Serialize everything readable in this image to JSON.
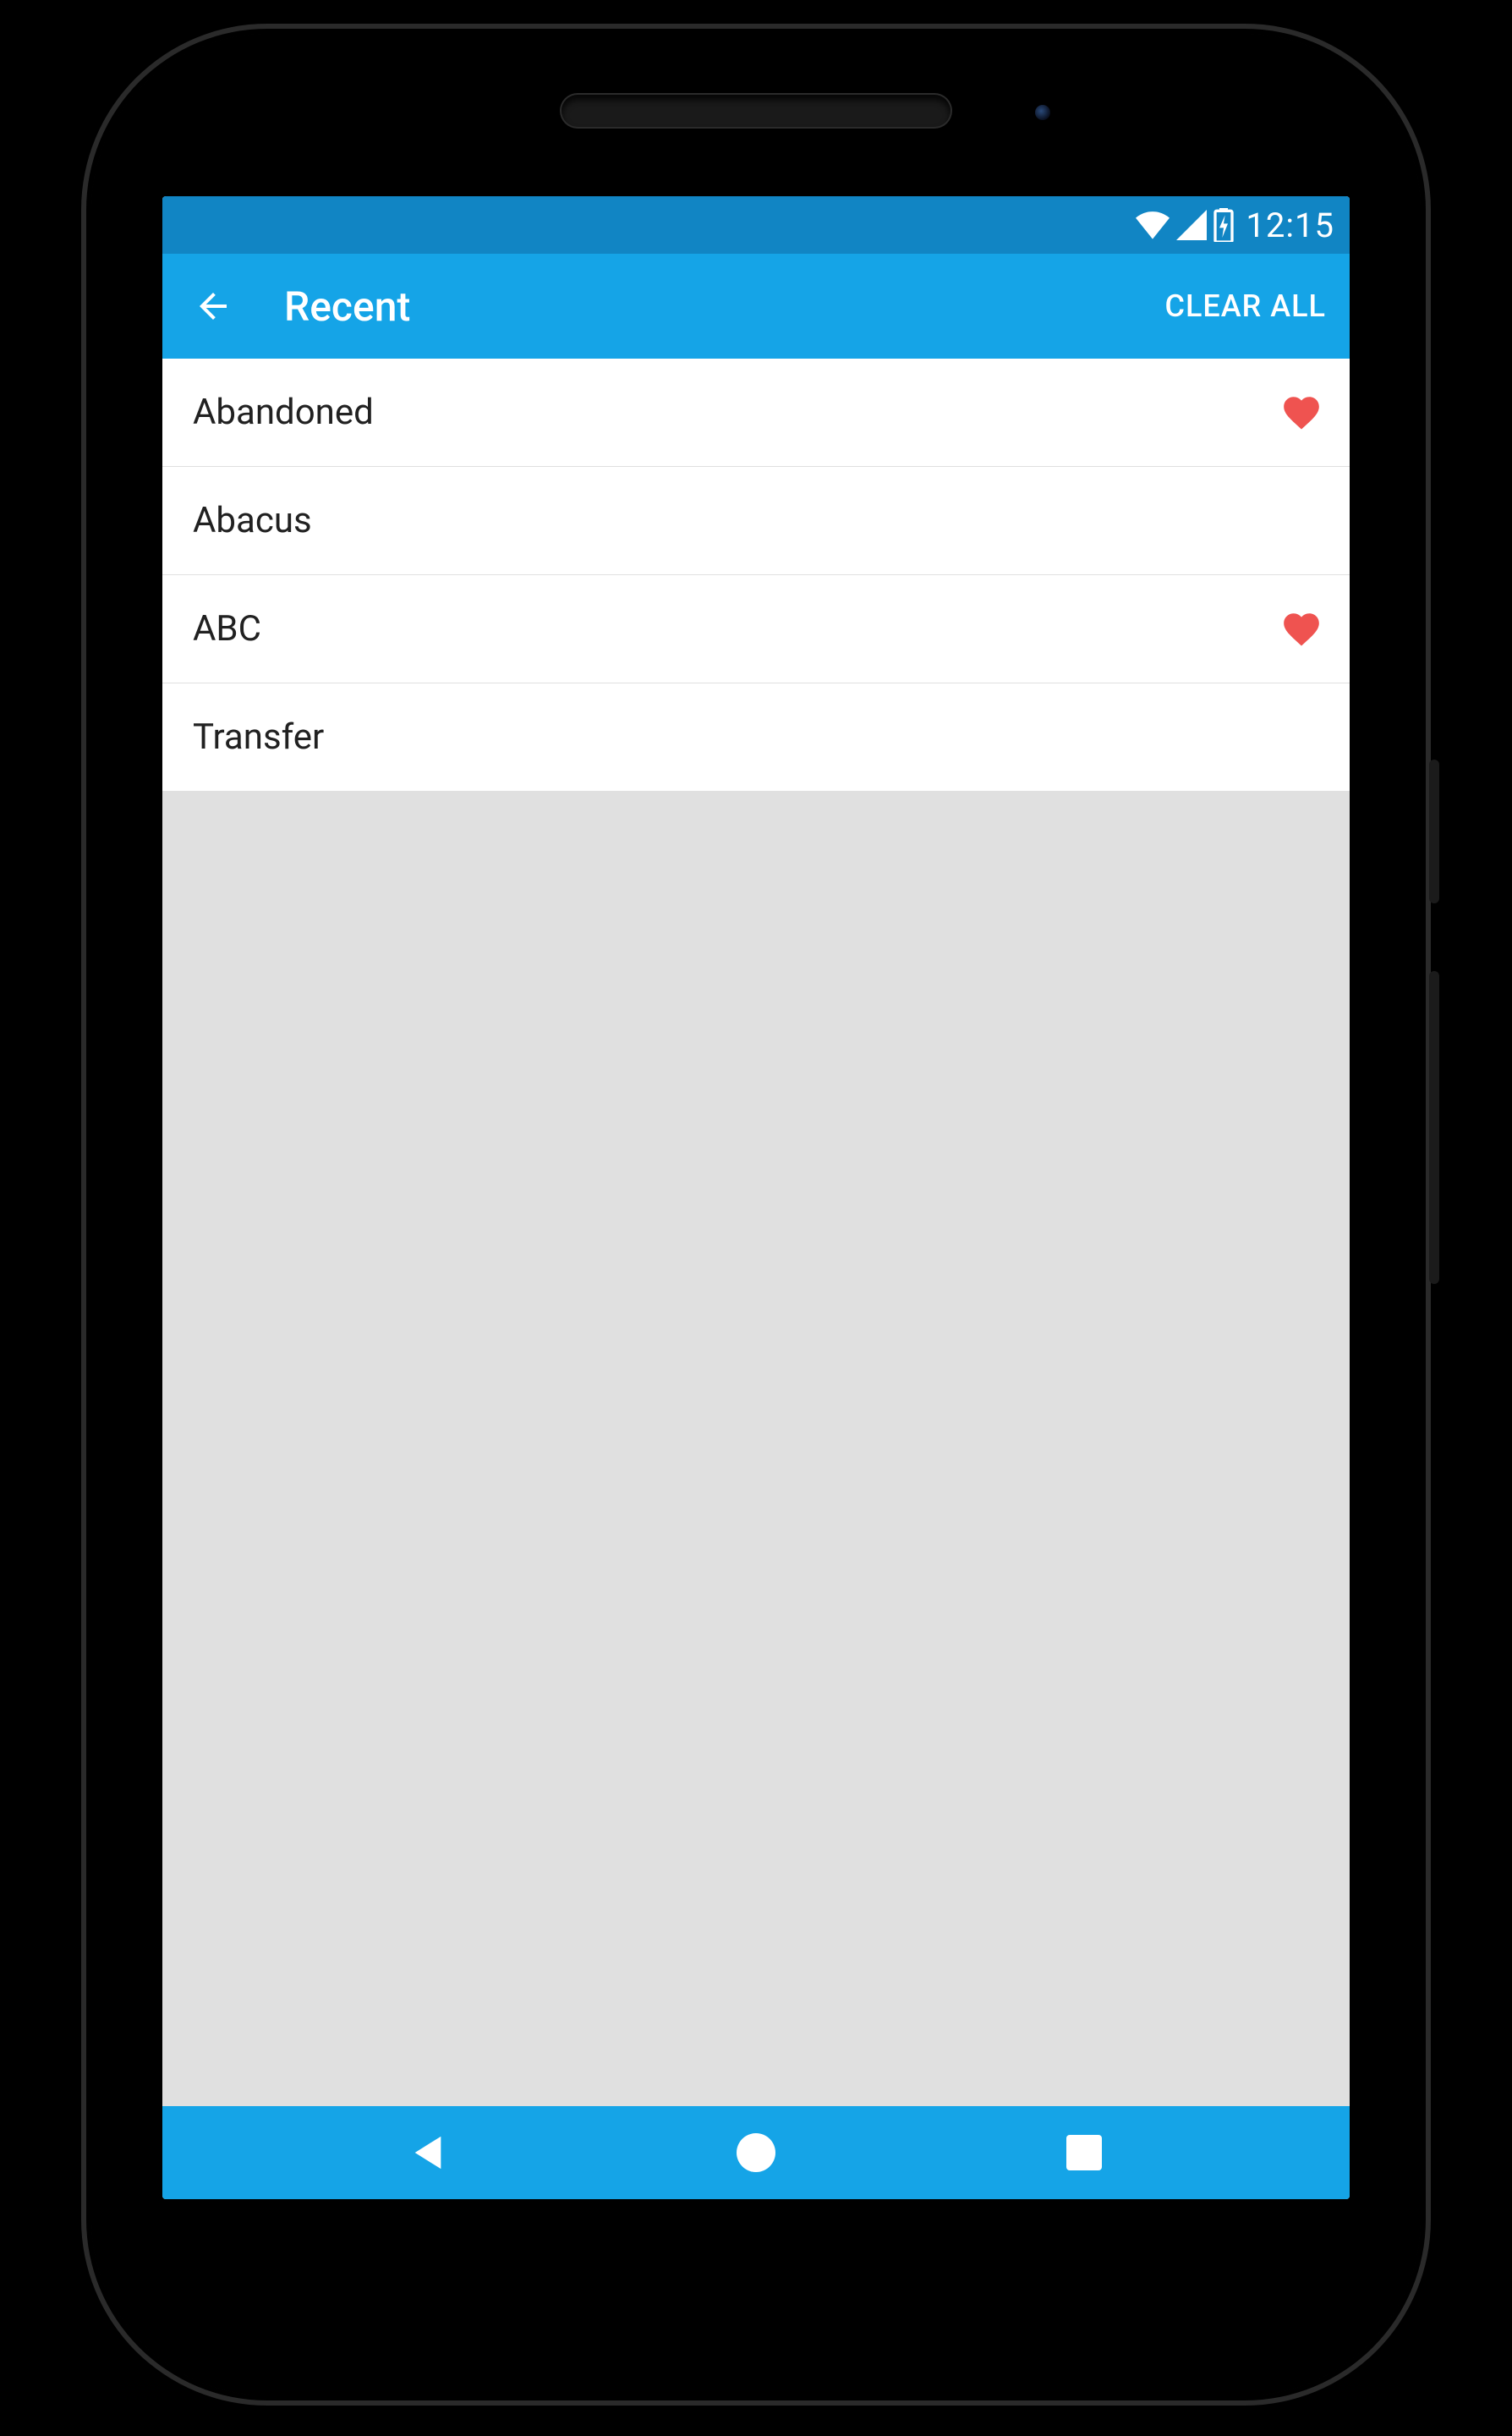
{
  "status": {
    "time": "12:15"
  },
  "appbar": {
    "title": "Recent",
    "clear_all": "CLEAR ALL"
  },
  "list": {
    "items": [
      {
        "label": "Abandoned",
        "favorite": true
      },
      {
        "label": "Abacus",
        "favorite": false
      },
      {
        "label": "ABC",
        "favorite": true
      },
      {
        "label": "Transfer",
        "favorite": false
      }
    ]
  }
}
